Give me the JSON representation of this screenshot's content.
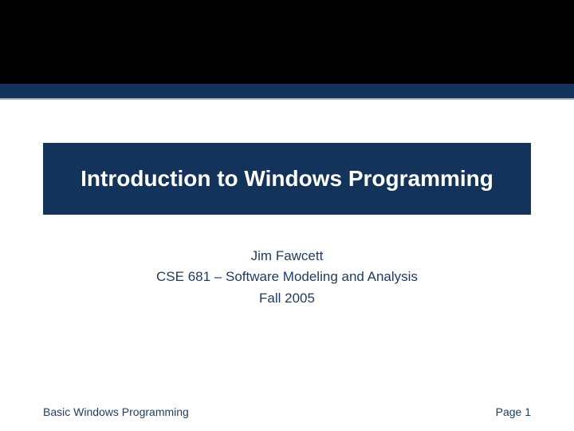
{
  "slide": {
    "title": "Introduction to Windows Programming",
    "author": "Jim Fawcett",
    "course": "CSE 681 – Software Modeling and Analysis",
    "term": "Fall 2005",
    "footer_left": "Basic Windows Programming",
    "footer_right": "Page 1"
  }
}
